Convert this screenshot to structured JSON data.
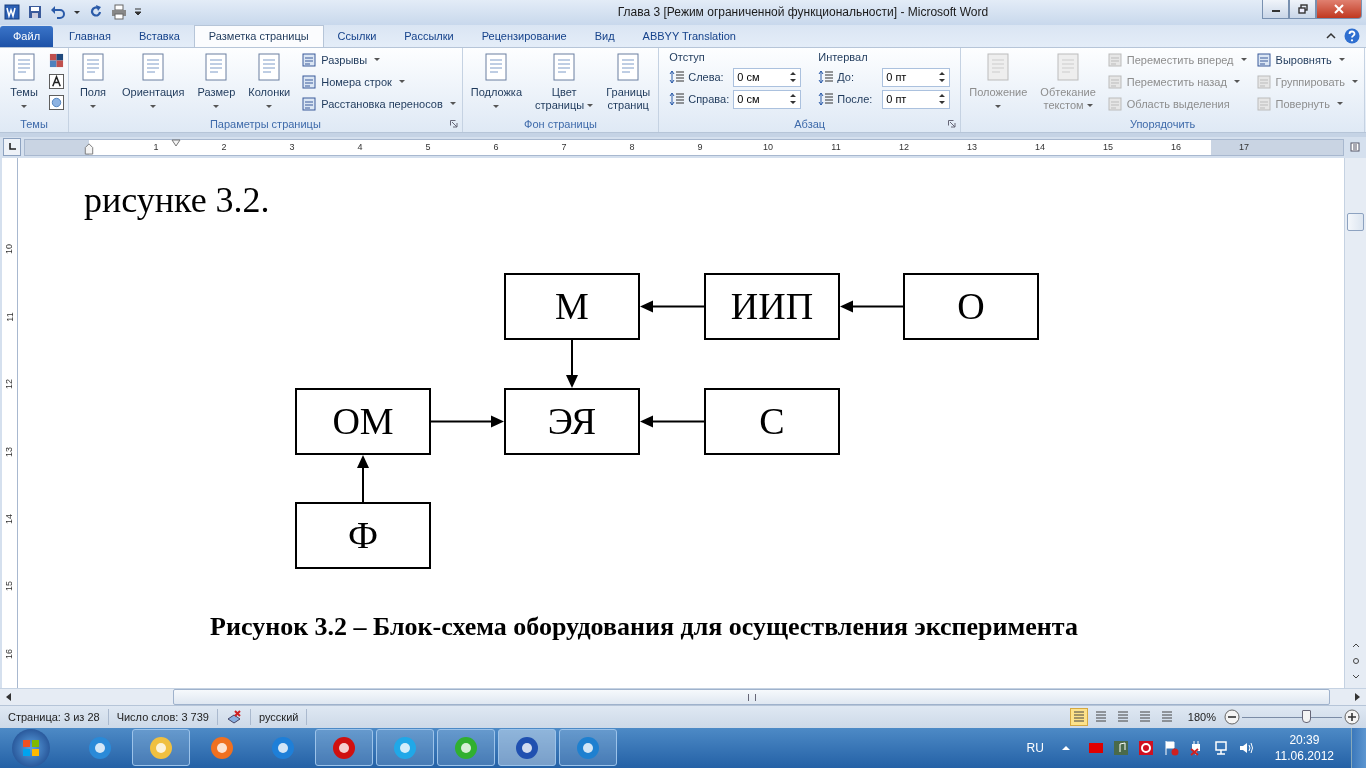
{
  "title_bar": {
    "title": "Глава 3 [Режим ограниченной функциональности]  -  Microsoft Word"
  },
  "tabs": [
    {
      "label": "Файл",
      "kind": "file",
      "selected": false
    },
    {
      "label": "Главная",
      "kind": "tab",
      "selected": false
    },
    {
      "label": "Вставка",
      "kind": "tab",
      "selected": false
    },
    {
      "label": "Разметка страницы",
      "kind": "tab",
      "selected": true
    },
    {
      "label": "Ссылки",
      "kind": "tab",
      "selected": false
    },
    {
      "label": "Рассылки",
      "kind": "tab",
      "selected": false
    },
    {
      "label": "Рецензирование",
      "kind": "tab",
      "selected": false
    },
    {
      "label": "Вид",
      "kind": "tab",
      "selected": false
    },
    {
      "label": "ABBYY Translation",
      "kind": "tab",
      "selected": false
    }
  ],
  "ribbon": {
    "groups": [
      {
        "label": "Темы",
        "launcher": false,
        "items": [
          {
            "kind": "large",
            "lines": [
              "Темы"
            ],
            "dropdown": true,
            "disabled": false
          },
          {
            "kind": "theme-icons"
          }
        ]
      },
      {
        "label": "Параметры страницы",
        "launcher": true,
        "items": [
          {
            "kind": "large",
            "lines": [
              "Поля"
            ],
            "dropdown": true,
            "disabled": false
          },
          {
            "kind": "large",
            "lines": [
              "Ориентация"
            ],
            "dropdown": true,
            "disabled": false
          },
          {
            "kind": "large",
            "lines": [
              "Размер"
            ],
            "dropdown": true,
            "disabled": false
          },
          {
            "kind": "large",
            "lines": [
              "Колонки"
            ],
            "dropdown": true,
            "disabled": false
          },
          {
            "kind": "small",
            "rows": [
              {
                "label": "Разрывы",
                "dropdown": true,
                "disabled": false
              },
              {
                "label": "Номера строк",
                "dropdown": true,
                "disabled": false
              },
              {
                "label": "Расстановка переносов",
                "dropdown": true,
                "disabled": false
              }
            ]
          }
        ]
      },
      {
        "label": "Фон страницы",
        "launcher": false,
        "items": [
          {
            "kind": "large",
            "lines": [
              "Подложка"
            ],
            "dropdown": true,
            "disabled": false
          },
          {
            "kind": "large",
            "lines": [
              "Цвет",
              "страницы"
            ],
            "dropdown": true,
            "disabled": false
          },
          {
            "kind": "large",
            "lines": [
              "Границы",
              "страниц"
            ],
            "dropdown": false,
            "disabled": false
          }
        ]
      },
      {
        "label": "Абзац",
        "launcher": true,
        "items": [
          {
            "kind": "spin",
            "heading": "Отступ",
            "rows": [
              {
                "label": "Слева:",
                "value": "0 см"
              },
              {
                "label": "Справа:",
                "value": "0 см"
              }
            ]
          },
          {
            "kind": "spin",
            "heading": "Интервал",
            "rows": [
              {
                "label": "До:",
                "value": "0 пт"
              },
              {
                "label": "После:",
                "value": "0 пт"
              }
            ]
          }
        ]
      },
      {
        "label": "Упорядочить",
        "launcher": false,
        "items": [
          {
            "kind": "large",
            "lines": [
              "Положение"
            ],
            "dropdown": true,
            "disabled": true
          },
          {
            "kind": "large",
            "lines": [
              "Обтекание",
              "текстом"
            ],
            "dropdown": true,
            "disabled": true
          },
          {
            "kind": "small",
            "rows": [
              {
                "label": "Переместить вперед",
                "dropdown": true,
                "disabled": true
              },
              {
                "label": "Переместить назад",
                "dropdown": true,
                "disabled": true
              },
              {
                "label": "Область выделения",
                "dropdown": false,
                "disabled": true
              }
            ]
          },
          {
            "kind": "small",
            "rows": [
              {
                "label": "Выровнять",
                "dropdown": true,
                "disabled": false
              },
              {
                "label": "Группировать",
                "dropdown": true,
                "disabled": true
              },
              {
                "label": "Повернуть",
                "dropdown": true,
                "disabled": true
              }
            ]
          }
        ]
      }
    ]
  },
  "ruler": {
    "marks": [
      "1",
      "2",
      "3",
      "4",
      "5",
      "6",
      "7",
      "8",
      "9",
      "10",
      "11",
      "12",
      "13",
      "14",
      "15",
      "16",
      "17"
    ]
  },
  "vertical_ruler": {
    "marks": [
      "10",
      "11",
      "12",
      "13",
      "14",
      "15",
      "16"
    ]
  },
  "document": {
    "paragraph": "рисунке 3.2.",
    "diagram": {
      "nodes": [
        {
          "label": "М"
        },
        {
          "label": "ИИП"
        },
        {
          "label": "О"
        },
        {
          "label": "ОМ"
        },
        {
          "label": "ЭЯ"
        },
        {
          "label": "С"
        },
        {
          "label": "Ф"
        }
      ]
    },
    "caption": "Рисунок 3.2 – Блок-схема оборудования для осуществления эксперимента"
  },
  "status_bar": {
    "page": "Страница: 3 из 28",
    "words": "Число слов: 3 739",
    "language": "русский",
    "views": [
      {
        "selected": true
      },
      {
        "selected": false
      },
      {
        "selected": false
      },
      {
        "selected": false
      },
      {
        "selected": false
      }
    ],
    "zoom": {
      "label": "180%",
      "level": 0.64
    }
  },
  "taskbar": {
    "apps": [
      {
        "running": false,
        "selected": false,
        "color": "#2a8ad8"
      },
      {
        "running": true,
        "selected": false,
        "color": "#f0c040"
      },
      {
        "running": false,
        "selected": false,
        "color": "#f07020"
      },
      {
        "running": false,
        "selected": false,
        "color": "#1e7fd8"
      },
      {
        "running": true,
        "selected": false,
        "color": "#d01010"
      },
      {
        "running": true,
        "selected": false,
        "color": "#20a8e8"
      },
      {
        "running": true,
        "selected": false,
        "color": "#30b030"
      },
      {
        "running": true,
        "selected": true,
        "color": "#2050b0"
      },
      {
        "running": true,
        "selected": false,
        "color": "#1e80d0"
      }
    ],
    "language": "RU",
    "time": "20:39",
    "date": "11.06.2012"
  }
}
